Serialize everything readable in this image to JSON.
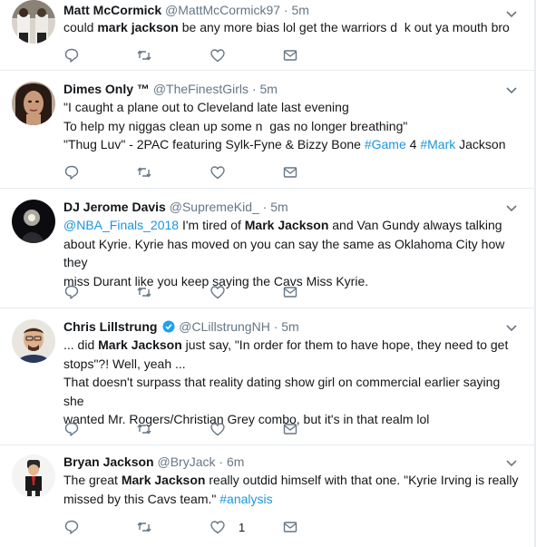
{
  "tweets": [
    {
      "name": "Matt McCormick",
      "handle": "@MattMcCormick97",
      "dot": "·",
      "time": "5m",
      "lines": [
        [
          {
            "t": "could ",
            "s": "n"
          },
          {
            "t": "mark jackson",
            "s": "b"
          },
          {
            "t": " be any more bias lol get the warriors d",
            "s": "n"
          },
          {
            "t": "  ",
            "s": "n"
          },
          {
            "t": "k out ya mouth bro",
            "s": "n"
          }
        ]
      ],
      "likes": ""
    },
    {
      "name": "Dimes Only ™",
      "handle": "@TheFinestGirls",
      "dot": "·",
      "time": "5m",
      "lines": [
        [
          {
            "t": "\"I caught a plane out to Cleveland late last evening",
            "s": "n"
          }
        ],
        [
          {
            "t": "To help my niggas clean up some n",
            "s": "n"
          },
          {
            "t": "  ",
            "s": "n"
          },
          {
            "t": "gas no longer breathing\"",
            "s": "n"
          }
        ],
        [
          {
            "t": "\"Thug Luv\" - 2PAC featuring Sylk-Fyne & Bizzy Bone ",
            "s": "n"
          },
          {
            "t": "#Game",
            "s": "l"
          },
          {
            "t": " 4 ",
            "s": "n"
          },
          {
            "t": "#Mark",
            "s": "l"
          },
          {
            "t": " Jackson",
            "s": "n"
          }
        ]
      ],
      "likes": ""
    },
    {
      "name": "DJ Jerome Davis",
      "handle": "@SupremeKid_",
      "dot": "·",
      "time": "5m",
      "lines": [
        [
          {
            "t": "@NBA_Finals_2018",
            "s": "l"
          },
          {
            "t": " I'm tired of ",
            "s": "n"
          },
          {
            "t": "Mark Jackson",
            "s": "b"
          },
          {
            "t": " and Van Gundy always talking",
            "s": "n"
          }
        ],
        [
          {
            "t": "about Kyrie. Kyrie has moved on you can say the same as Oklahoma City how they",
            "s": "n"
          }
        ],
        [
          {
            "t": "miss Durant like you keep saying the Cavs Miss Kyrie.",
            "s": "n"
          }
        ]
      ],
      "likes": ""
    },
    {
      "name": "Chris Lillstrung",
      "handle": "@CLillstrungNH",
      "dot": "·",
      "time": "5m",
      "verified": true,
      "lines": [
        [
          {
            "t": "... did ",
            "s": "n"
          },
          {
            "t": "Mark Jackson",
            "s": "b"
          },
          {
            "t": " just say, \"In order for them to have hope, they need to get",
            "s": "n"
          }
        ],
        [
          {
            "t": "stops\"?! Well, yeah ...",
            "s": "n"
          }
        ],
        [
          {
            "t": "That doesn't surpass that reality dating show girl on commercial earlier saying she",
            "s": "n"
          }
        ],
        [
          {
            "t": "wanted Mr. Rogers/Christian Grey combo, but it's in that realm lol",
            "s": "n"
          }
        ]
      ],
      "likes": ""
    },
    {
      "name": "Bryan Jackson",
      "handle": "@BryJack",
      "dot": "·",
      "time": "6m",
      "lines": [
        [
          {
            "t": "The great ",
            "s": "n"
          },
          {
            "t": "Mark Jackson",
            "s": "b"
          },
          {
            "t": " really outdid himself with that one. \"Kyrie Irving is really",
            "s": "n"
          }
        ],
        [
          {
            "t": "missed by this Cavs team.\" ",
            "s": "n"
          },
          {
            "t": "#analysis",
            "s": "l"
          }
        ]
      ],
      "likes": "1"
    }
  ],
  "icons": {
    "reply": "reply-icon",
    "retweet": "retweet-icon",
    "like": "heart-icon",
    "dm": "envelope-icon",
    "more": "chevron-down-icon",
    "verified": "verified-badge-icon"
  },
  "colors": {
    "link": "#1b95e0",
    "verified": "#1da1f2",
    "muted": "#657786",
    "border": "#e6ecf0"
  }
}
